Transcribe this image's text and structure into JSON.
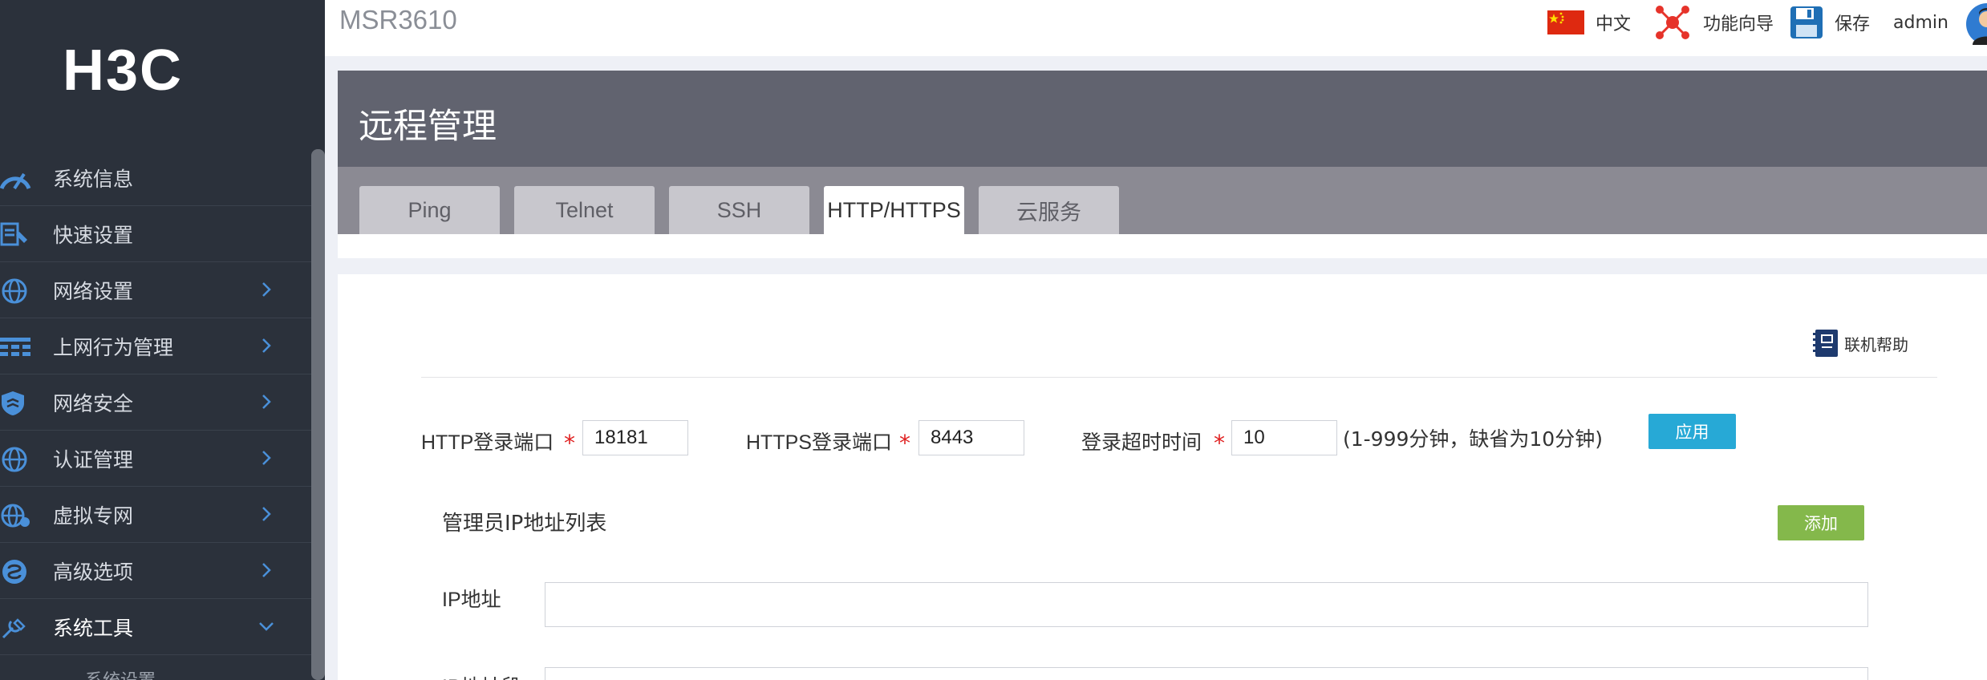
{
  "brand": {
    "logo_text": "H3C"
  },
  "topbar": {
    "model": "MSR3610",
    "language_label": "中文",
    "wizard_label": "功能向导",
    "save_label": "保存",
    "user_label": "admin"
  },
  "sidebar": {
    "items": [
      {
        "label": "系统信息",
        "icon": "dashboard-icon",
        "expandable": false
      },
      {
        "label": "快速设置",
        "icon": "quick-setup-icon",
        "expandable": false
      },
      {
        "label": "网络设置",
        "icon": "globe-icon",
        "expandable": true
      },
      {
        "label": "上网行为管理",
        "icon": "behavior-grid-icon",
        "expandable": true
      },
      {
        "label": "网络安全",
        "icon": "shield-icon",
        "expandable": true
      },
      {
        "label": "认证管理",
        "icon": "globe-icon",
        "expandable": true
      },
      {
        "label": "虚拟专网",
        "icon": "vpn-globe-icon",
        "expandable": true
      },
      {
        "label": "高级选项",
        "icon": "advanced-icon",
        "expandable": true
      },
      {
        "label": "系统工具",
        "icon": "tools-icon",
        "expandable": true,
        "expanded": true
      }
    ],
    "sub_items": [
      "系统设置"
    ]
  },
  "page": {
    "title": "远程管理",
    "tabs": [
      "Ping",
      "Telnet",
      "SSH",
      "HTTP/HTTPS",
      "云服务"
    ],
    "active_tab": "HTTP/HTTPS",
    "help_label": "联机帮助"
  },
  "form": {
    "http_port_label": "HTTP登录端口",
    "http_port_value": "18181",
    "https_port_label": "HTTPS登录端口",
    "https_port_value": "8443",
    "timeout_label": "登录超时时间",
    "timeout_value": "10",
    "timeout_hint": "(1-999分钟，缺省为10分钟)",
    "required_mark": "*",
    "apply_label": "应用"
  },
  "admin_ip": {
    "title": "管理员IP地址列表",
    "add_label": "添加",
    "ip_label": "IP地址",
    "ip_range_label": "IP地址段"
  },
  "colors": {
    "sidebar_bg": "#2b313b",
    "header_bg": "#61636f",
    "tabbar_bg": "#8b8a93",
    "apply_btn": "#27a9d6",
    "add_btn": "#84b84b",
    "required": "#e02020",
    "icon_blue": "#4a90d9"
  }
}
